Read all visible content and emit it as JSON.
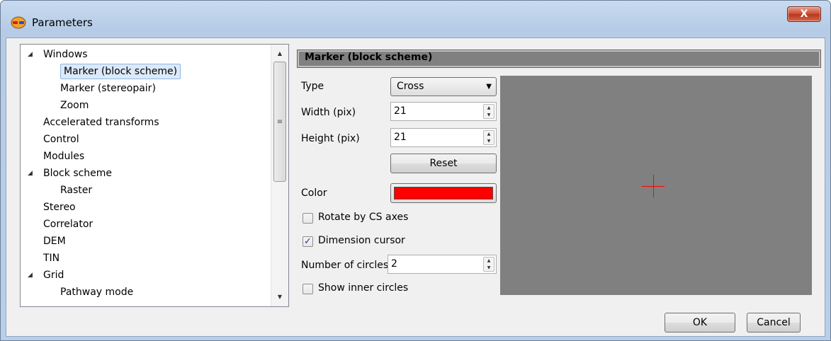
{
  "window": {
    "title": "Parameters",
    "close_label": "X"
  },
  "tree": {
    "items": [
      {
        "label": "Windows",
        "level": 0,
        "expanded": true
      },
      {
        "label": "Marker (block scheme)",
        "level": 1,
        "selected": true
      },
      {
        "label": "Marker (stereopair)",
        "level": 1
      },
      {
        "label": "Zoom",
        "level": 1
      },
      {
        "label": "Accelerated transforms",
        "level": 0
      },
      {
        "label": "Control",
        "level": 0
      },
      {
        "label": "Modules",
        "level": 0
      },
      {
        "label": "Block scheme",
        "level": 0,
        "expanded": true
      },
      {
        "label": "Raster",
        "level": 1
      },
      {
        "label": "Stereo",
        "level": 0
      },
      {
        "label": "Correlator",
        "level": 0
      },
      {
        "label": "DEM",
        "level": 0
      },
      {
        "label": "TIN",
        "level": 0
      },
      {
        "label": "Grid",
        "level": 0,
        "expanded": true
      },
      {
        "label": "Pathway mode",
        "level": 1
      }
    ]
  },
  "panel": {
    "header": "Marker (block scheme)",
    "type_label": "Type",
    "type_value": "Cross",
    "width_label": "Width (pix)",
    "width_value": "21",
    "height_label": "Height (pix)",
    "height_value": "21",
    "reset_label": "Reset",
    "color_label": "Color",
    "color_value": "#ff0000",
    "rotate_label": "Rotate by CS axes",
    "rotate_checked": false,
    "dimension_label": "Dimension cursor",
    "dimension_checked": true,
    "circles_label": "Number of circles",
    "circles_value": "2",
    "inner_circles_label": "Show inner circles",
    "inner_circles_checked": false
  },
  "preview": {
    "background": "#808080",
    "cursor_color": "#ff0000"
  },
  "buttons": {
    "ok_label": "OK",
    "cancel_label": "Cancel"
  }
}
